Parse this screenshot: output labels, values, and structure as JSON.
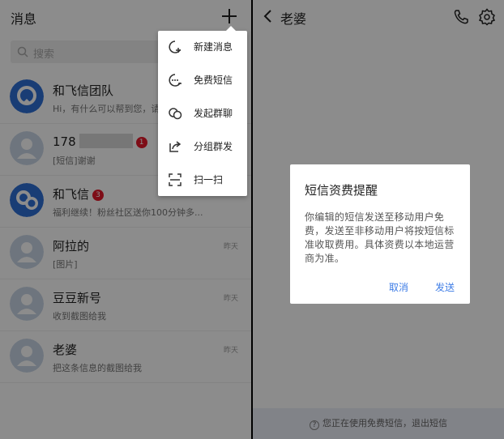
{
  "left": {
    "title": "消息",
    "search_placeholder": "搜索",
    "conversations": [
      {
        "name": "和飞信团队",
        "preview": "Hi，有什么可以帮到您，请",
        "time": "",
        "badge": ""
      },
      {
        "name": "178",
        "preview": "[短信]谢谢",
        "time": "",
        "badge": "1"
      },
      {
        "name": "和飞信",
        "preview": "福利继续！粉丝社区送你100分钟多...",
        "time": "",
        "badge": "3"
      },
      {
        "name": "阿拉的",
        "preview": "[图片]",
        "time": "昨天",
        "badge": ""
      },
      {
        "name": "豆豆新号",
        "preview": "收到截图给我",
        "time": "昨天",
        "badge": ""
      },
      {
        "name": "老婆",
        "preview": "把这条信息的截图给我",
        "time": "昨天",
        "badge": ""
      }
    ],
    "menu": [
      {
        "label": "新建消息",
        "icon": "new-message-icon"
      },
      {
        "label": "免费短信",
        "icon": "free-sms-icon"
      },
      {
        "label": "发起群聊",
        "icon": "group-chat-icon"
      },
      {
        "label": "分组群发",
        "icon": "group-send-icon"
      },
      {
        "label": "扫一扫",
        "icon": "scan-icon"
      }
    ]
  },
  "right": {
    "title": "老婆",
    "bottom_info": "您正在使用免费短信，退出短信",
    "dialog": {
      "title": "短信资费提醒",
      "body": "你编辑的短信发送至移动用户免费，发送至非移动用户将按短信标准收取费用。具体资费以本地运营商为准。",
      "cancel": "取消",
      "send": "发送"
    }
  },
  "colors": {
    "accent": "#3f7de6",
    "badge": "#e6192b",
    "avatar_brand": "#2f6fd6",
    "avatar_default": "#c8d6e6"
  }
}
